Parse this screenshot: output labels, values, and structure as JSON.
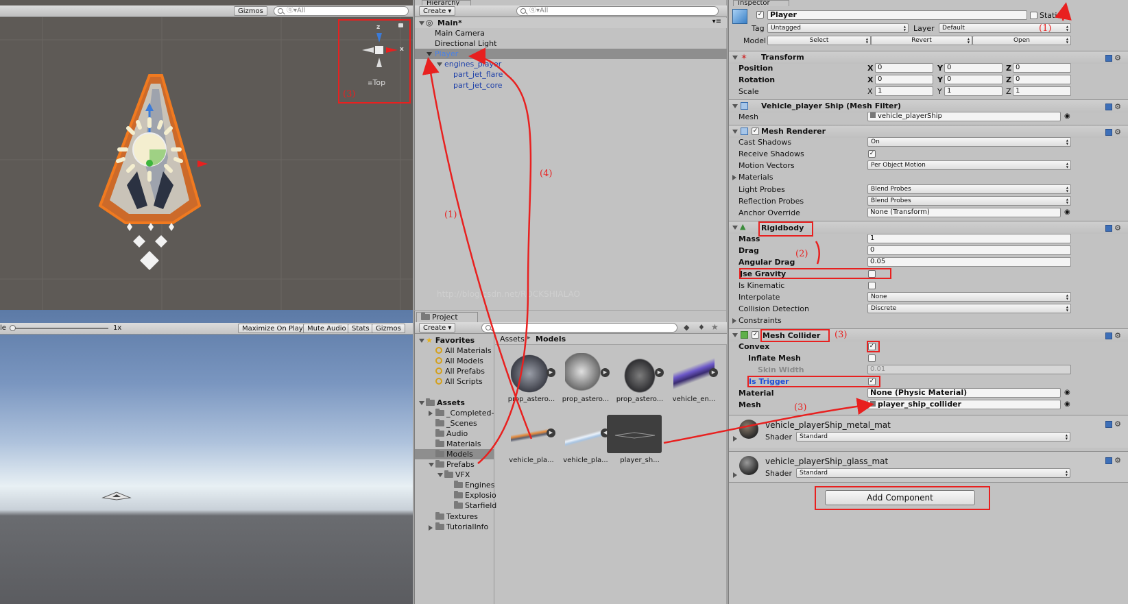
{
  "scene": {
    "gizmos": "Gizmos",
    "search_placeholder": "ⓠ▾All",
    "view_label": "Top",
    "axis_z": "z",
    "axis_x": "x"
  },
  "game": {
    "scale_label": "1x",
    "scale_prefix": "le",
    "maximize": "Maximize On Play",
    "mute": "Mute Audio",
    "stats": "Stats",
    "gizmos": "Gizmos"
  },
  "hierarchy": {
    "tab": "Hierarchy",
    "create": "Create ▾",
    "search_placeholder": "ⓠ▾All",
    "scene_name": "Main*",
    "items": [
      "Main Camera",
      "Directional Light",
      "Player",
      "engines_player",
      "part_jet_flare",
      "part_jet_core"
    ]
  },
  "project": {
    "tab": "Project",
    "create": "Create ▾",
    "favorites": "Favorites",
    "fav_items": [
      "All Materials",
      "All Models",
      "All Prefabs",
      "All Scripts"
    ],
    "assets": "Assets",
    "folders": [
      "_Completed-",
      "_Scenes",
      "Audio",
      "Materials",
      "Models",
      "Prefabs",
      "VFX",
      "Engines",
      "Explosio",
      "Starfield",
      "Textures",
      "TutorialInfo"
    ],
    "breadcrumb_root": "Assets",
    "breadcrumb_current": "Models",
    "thumbs": [
      "prop_astero...",
      "prop_astero...",
      "prop_astero...",
      "vehicle_en...",
      "vehicle_pla...",
      "vehicle_pla...",
      "player_sh..."
    ]
  },
  "inspector": {
    "tab": "Inspector",
    "object_name": "Player",
    "static_label": "Static",
    "tag_label": "Tag",
    "tag_value": "Untagged",
    "layer_label": "Layer",
    "layer_value": "Default",
    "model_label": "Model",
    "select": "Select",
    "revert": "Revert",
    "open": "Open",
    "transform": {
      "title": "Transform",
      "position": "Position",
      "rotation": "Rotation",
      "scale": "Scale",
      "pos": [
        "0",
        "0",
        "0"
      ],
      "rot": [
        "0",
        "0",
        "0"
      ],
      "scl": [
        "1",
        "1",
        "1"
      ],
      "x": "X",
      "y": "Y",
      "z": "Z"
    },
    "mesh_filter": {
      "title": "Vehicle_player Ship (Mesh Filter)",
      "mesh_label": "Mesh",
      "mesh_value": "vehicle_playerShip"
    },
    "mesh_renderer": {
      "title": "Mesh Renderer",
      "cast_shadows": "Cast Shadows",
      "cast_shadows_value": "On",
      "receive_shadows": "Receive Shadows",
      "motion_vectors": "Motion Vectors",
      "motion_vectors_value": "Per Object Motion",
      "materials": "Materials",
      "light_probes": "Light Probes",
      "light_probes_value": "Blend Probes",
      "reflection_probes": "Reflection Probes",
      "reflection_probes_value": "Blend Probes",
      "anchor_override": "Anchor Override",
      "anchor_override_value": "None (Transform)"
    },
    "rigidbody": {
      "title": "Rigidbody",
      "mass": "Mass",
      "mass_value": "1",
      "drag": "Drag",
      "drag_value": "0",
      "angular_drag": "Angular Drag",
      "angular_drag_value": "0.05",
      "use_gravity": "Jse Gravity",
      "is_kinematic": "Is Kinematic",
      "interpolate": "Interpolate",
      "interpolate_value": "None",
      "collision_detection": "Collision Detection",
      "collision_detection_value": "Discrete",
      "constraints": "Constraints"
    },
    "mesh_collider": {
      "title": "Mesh Collider",
      "convex": "Convex",
      "inflate_mesh": "Inflate Mesh",
      "skin_width": "Skin Width",
      "skin_width_value": "0.01",
      "is_trigger": "Is Trigger",
      "material": "Material",
      "material_value": "None (Physic Material)",
      "mesh": "Mesh",
      "mesh_value": "player_ship_collider"
    },
    "mat1": {
      "name": "vehicle_playerShip_metal_mat",
      "shader_label": "Shader",
      "shader_value": "Standard"
    },
    "mat2": {
      "name": "vehicle_playerShip_glass_mat",
      "shader_label": "Shader",
      "shader_value": "Standard"
    },
    "add_component": "Add Component"
  },
  "annotations": {
    "a1": "(1)",
    "a2": "(2)",
    "a3": "(3)",
    "a4": "(4)",
    "watermark": "http://blog.csdn.net/ROCKSHIALAO"
  },
  "colors": {
    "annotation_red": "#e8201f",
    "selection_blue": "#3d6fb8",
    "scene_bg": "#5d5a55"
  }
}
